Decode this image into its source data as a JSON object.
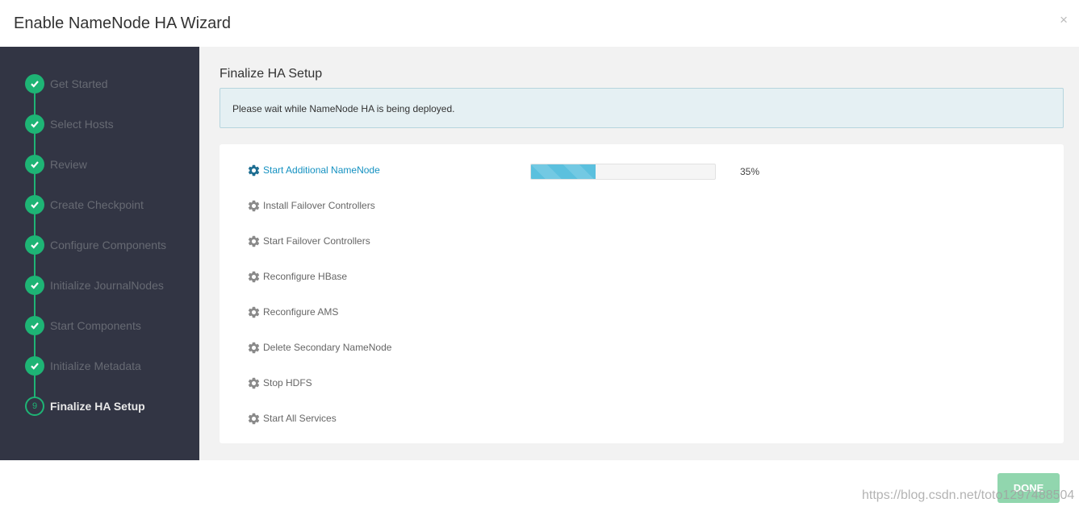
{
  "wizard": {
    "title": "Enable NameNode HA Wizard",
    "close_glyph": "×"
  },
  "colors": {
    "accent_green": "#1eb475",
    "sidebar_bg": "#323544",
    "link_blue": "#1491c1"
  },
  "steps": [
    {
      "label": "Get Started",
      "state": "completed"
    },
    {
      "label": "Select Hosts",
      "state": "completed"
    },
    {
      "label": "Review",
      "state": "completed"
    },
    {
      "label": "Create Checkpoint",
      "state": "completed"
    },
    {
      "label": "Configure Components",
      "state": "completed"
    },
    {
      "label": "Initialize JournalNodes",
      "state": "completed"
    },
    {
      "label": "Start Components",
      "state": "completed"
    },
    {
      "label": "Initialize Metadata",
      "state": "completed"
    },
    {
      "label": "Finalize HA Setup",
      "state": "current",
      "number": "9"
    }
  ],
  "main": {
    "title": "Finalize HA Setup",
    "alert": "Please wait while NameNode HA is being deployed."
  },
  "tasks": [
    {
      "label": "Start Additional NameNode",
      "icon": "gear-icon",
      "status": "in-progress",
      "progress": 35,
      "progress_text": "35%"
    },
    {
      "label": "Install Failover Controllers",
      "icon": "gear-icon",
      "status": "pending"
    },
    {
      "label": "Start Failover Controllers",
      "icon": "gear-icon",
      "status": "pending"
    },
    {
      "label": "Reconfigure HBase",
      "icon": "gear-icon",
      "status": "pending"
    },
    {
      "label": "Reconfigure AMS",
      "icon": "gear-icon",
      "status": "pending"
    },
    {
      "label": "Delete Secondary NameNode",
      "icon": "gear-icon",
      "status": "pending"
    },
    {
      "label": "Stop HDFS",
      "icon": "gear-icon",
      "status": "pending"
    },
    {
      "label": "Start All Services",
      "icon": "gear-icon",
      "status": "pending"
    }
  ],
  "footer": {
    "done_label": "DONE",
    "watermark": "https://blog.csdn.net/toto1297488504"
  }
}
